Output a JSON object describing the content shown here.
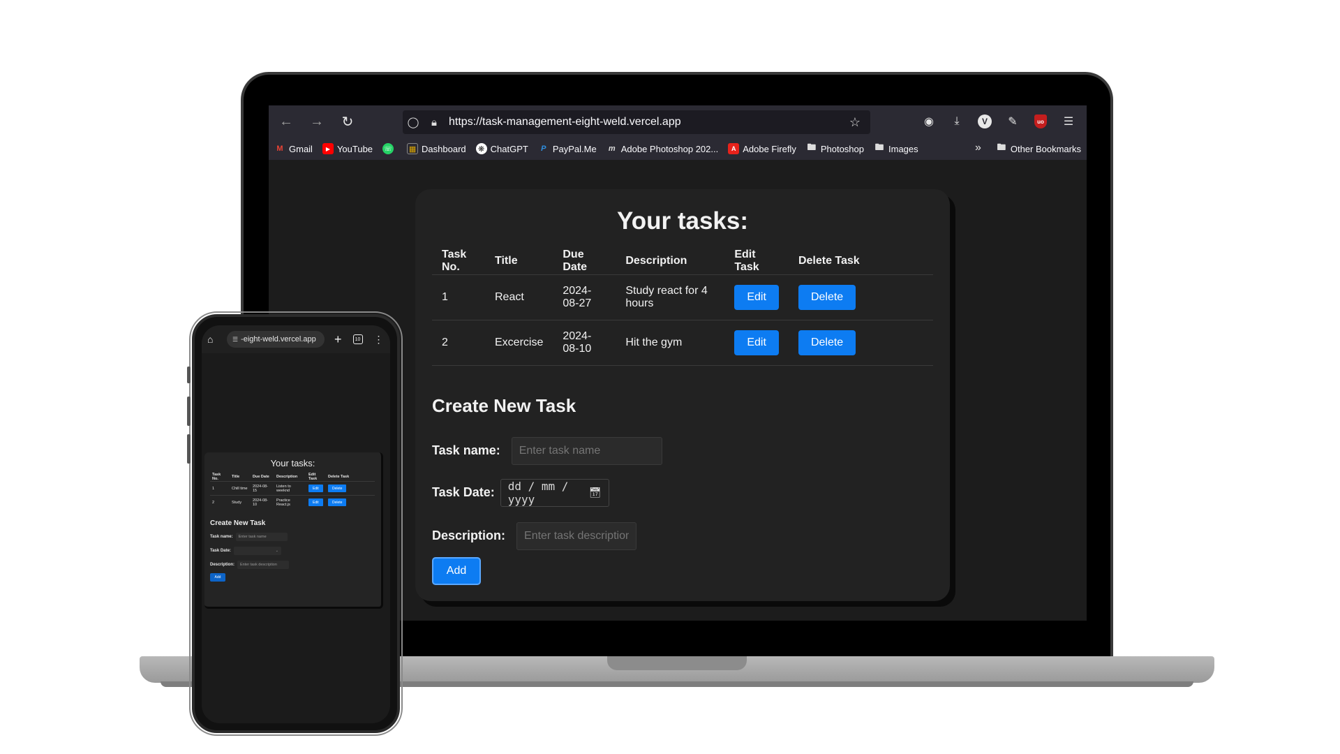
{
  "browser": {
    "url": "https://task-management-eight-weld.vercel.app",
    "bookmarks": [
      "Gmail",
      "YouTube",
      "",
      "Dashboard",
      "ChatGPT",
      "PayPal.Me",
      "Adobe Photoshop 202...",
      "Adobe Firefly",
      "Photoshop",
      "Images"
    ],
    "other_bookmarks": "Other Bookmarks",
    "profile_badge": "V",
    "ublock_badge": "uo"
  },
  "app": {
    "title": "Your tasks:",
    "columns": [
      "Task No.",
      "Title",
      "Due Date",
      "Description",
      "Edit Task",
      "Delete Task"
    ],
    "tasks": [
      {
        "no": "1",
        "title": "React",
        "due": "2024-08-27",
        "description": "Study react for 4 hours"
      },
      {
        "no": "2",
        "title": "Excercise",
        "due": "2024-08-10",
        "description": "Hit the gym"
      }
    ],
    "edit_label": "Edit",
    "delete_label": "Delete",
    "form": {
      "heading": "Create New Task",
      "name_label": "Task name:",
      "name_placeholder": "Enter task name",
      "date_label": "Task Date:",
      "date_placeholder": "dd / mm / yyyy",
      "desc_label": "Description:",
      "desc_placeholder": "Enter task description",
      "add_label": "Add"
    }
  },
  "phone": {
    "url": "-eight-weld.vercel.app",
    "tab_count": "10",
    "title": "Your tasks:",
    "columns": [
      "Task No.",
      "Title",
      "Due Date",
      "Description",
      "Edit Task",
      "Delete Task"
    ],
    "tasks": [
      {
        "no": "1",
        "title": "Chill time",
        "due": "2024-08-15",
        "description": "Listen to weeknd"
      },
      {
        "no": "2",
        "title": "Study",
        "due": "2024-08-10",
        "description": "Practice React.js"
      }
    ],
    "edit_label": "Edit",
    "delete_label": "Delete",
    "form": {
      "heading": "Create New Task",
      "name_label": "Task name:",
      "name_placeholder": "Enter task name",
      "date_label": "Task Date:",
      "desc_label": "Description:",
      "desc_placeholder": "Enter task description",
      "add_label": "Add"
    }
  },
  "colors": {
    "accent": "#0d7cf2",
    "card_bg": "#222222",
    "page_bg": "#1c1c1c"
  }
}
